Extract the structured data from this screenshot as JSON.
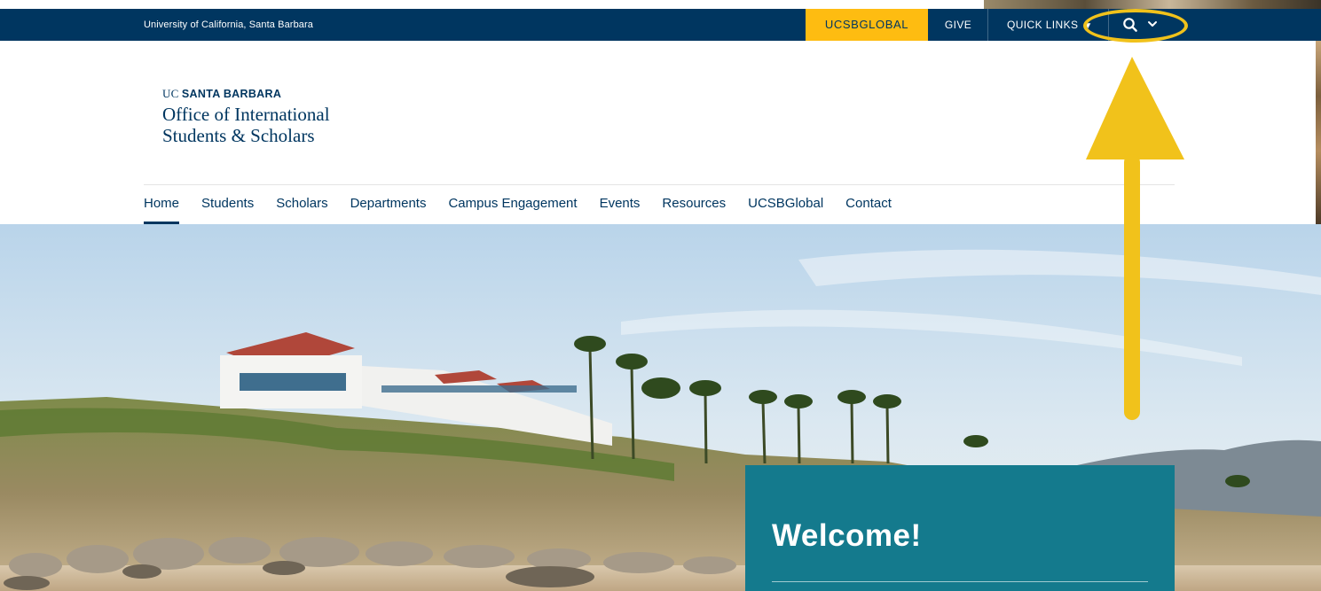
{
  "utility_bar": {
    "institution": "University of California, Santa Barbara",
    "ucsbglobal_label": "UCSBGLOBAL",
    "give_label": "GIVE",
    "quick_links_label": "QUICK LINKS",
    "search_icon": "search-icon",
    "chevron_icon": "chevron-down-icon"
  },
  "brand": {
    "uc_prefix": "UC",
    "campus": "SANTA BARBARA",
    "office_line1": "Office of International",
    "office_line2": "Students & Scholars"
  },
  "main_nav": {
    "items": [
      {
        "label": "Home",
        "active": true
      },
      {
        "label": "Students"
      },
      {
        "label": "Scholars"
      },
      {
        "label": "Departments"
      },
      {
        "label": "Campus Engagement"
      },
      {
        "label": "Events"
      },
      {
        "label": "Resources"
      },
      {
        "label": "UCSBGlobal"
      },
      {
        "label": "Contact"
      }
    ]
  },
  "hero": {
    "welcome_title": "Welcome!"
  },
  "annotation": {
    "color": "#f1c21b",
    "target": "search-toggle"
  },
  "colors": {
    "navy": "#003660",
    "gold": "#febc11",
    "teal": "#147a8d"
  }
}
